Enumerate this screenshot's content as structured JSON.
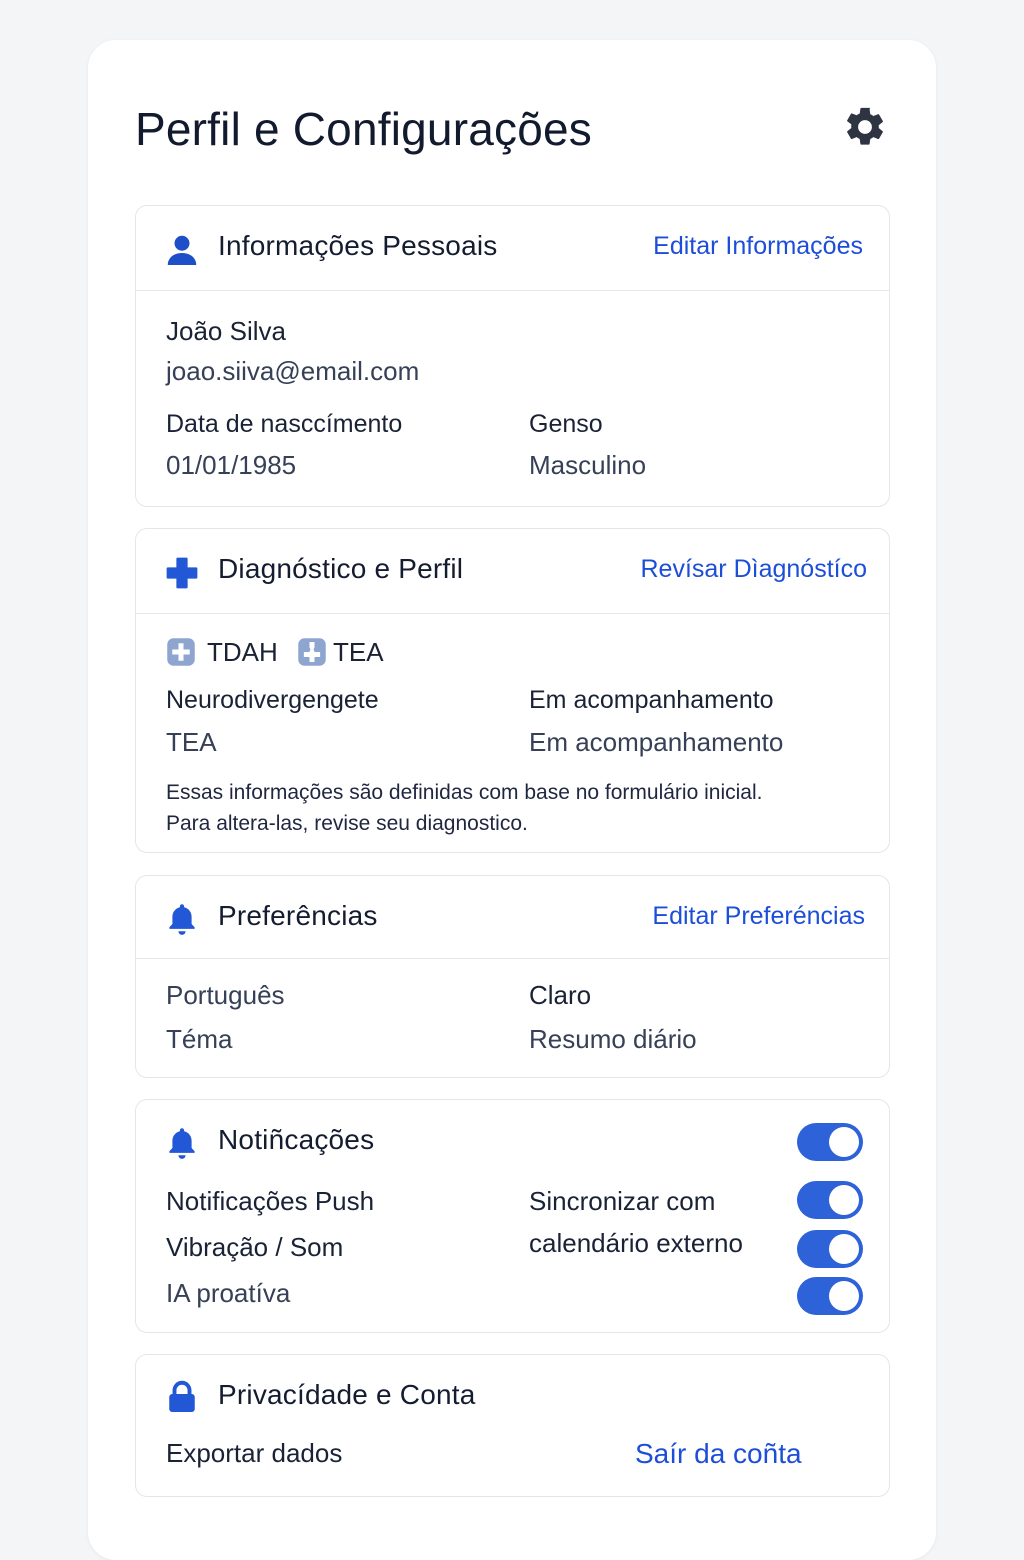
{
  "header": {
    "title": "Perfil e Configurações",
    "settings_icon": "gear-icon"
  },
  "personal": {
    "title": "Informações Pessoais",
    "edit_label": "Editar Informações",
    "name": "João Silva",
    "email": "joao.siiva@email.com",
    "birth_label": "Data de nasccímento",
    "birth_value": "01/01/1985",
    "gender_label": "Genso",
    "gender_value": "Masculino"
  },
  "diagnosis": {
    "title": "Diagnóstico e Perfil",
    "review_label": "Revísar Dìagnóstíco",
    "tags": [
      "TDAH",
      "TEA"
    ],
    "neuro_label": "Neurodivergengete",
    "neuro_value": "TEA",
    "follow_label": "Em acompanhamento",
    "follow_value": "Em acompanhamento",
    "note_line1": "Essas informações são definidas com base no formulário inicial.",
    "note_line2": "Para altera-las, revise seu diagnostico."
  },
  "preferences": {
    "title": "Preferências",
    "edit_label": "Editar Preferéncias",
    "language": "Português",
    "theme_label": "Téma",
    "theme_value": "Claro",
    "summary": "Resumo diário"
  },
  "notifications": {
    "title": "Notiñcações",
    "push_label": "Notificações Push",
    "vibration_label": "Vibração / Som",
    "ai_label": "IA proatíva",
    "sync_line1": "Sincronizar com",
    "sync_line2": "calendário externo",
    "toggles": {
      "master": true,
      "push": true,
      "vibration": true,
      "ai": true
    }
  },
  "privacy": {
    "title": "Privacídade e Conta",
    "export_label": "Exportar dados",
    "logout_label": "Saír da coñta"
  },
  "colors": {
    "accent": "#2d62d9",
    "link": "#1d4ed8",
    "text": "#141c30"
  }
}
